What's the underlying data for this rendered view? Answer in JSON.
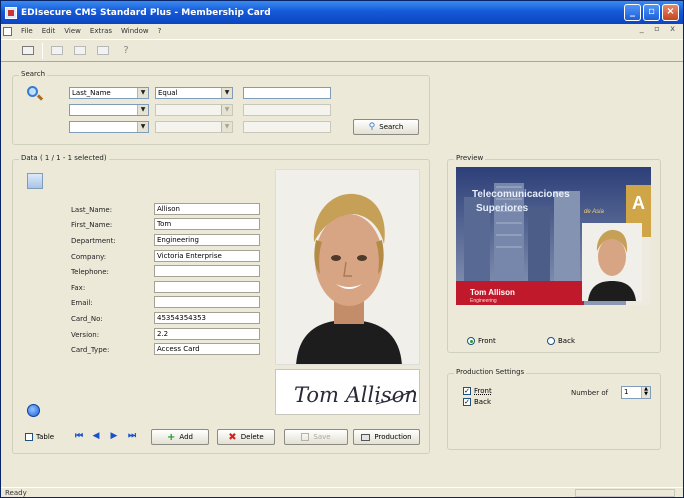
{
  "window": {
    "title": "EDIsecure CMS Standard Plus - Membership Card",
    "menu": [
      "File",
      "Edit",
      "View",
      "Extras",
      "Window",
      "?"
    ],
    "mdi_controls": "_ ▫ x"
  },
  "search": {
    "group_title": "Search",
    "rows": [
      {
        "field": "Last_Name",
        "operator": "Equal",
        "value": ""
      },
      {
        "field": "",
        "operator": "",
        "value": ""
      },
      {
        "field": "",
        "operator": "",
        "value": ""
      }
    ],
    "search_button": "Search"
  },
  "data_group": {
    "title": "Data ( 1 / 1 - 1 selected)",
    "fields": [
      {
        "label": "Last_Name:",
        "value": "Allison"
      },
      {
        "label": "First_Name:",
        "value": "Tom"
      },
      {
        "label": "Department:",
        "value": "Engineering"
      },
      {
        "label": "Company:",
        "value": "Victoria Enterprise"
      },
      {
        "label": "Telephone:",
        "value": ""
      },
      {
        "label": "Fax:",
        "value": ""
      },
      {
        "label": "Email:",
        "value": ""
      },
      {
        "label": "Card_No:",
        "value": "45354354353"
      },
      {
        "label": "Version:",
        "value": "2.2"
      },
      {
        "label": "Card_Type:",
        "value": "Access Card"
      }
    ],
    "signature_text": "Tom Allison",
    "table_checkbox_label": "Table",
    "buttons": {
      "add": "Add",
      "delete": "Delete",
      "save": "Save",
      "production": "Production"
    }
  },
  "preview": {
    "title": "Preview",
    "card": {
      "heading_line1": "Telecomunicaciones",
      "heading_line2": "Superiores",
      "tag": "de Asia",
      "corner_letter": "A",
      "name": "Tom Allison",
      "department": "Engineering"
    },
    "side_front": "Front",
    "side_back": "Back",
    "selected_side": "Front"
  },
  "production_settings": {
    "title": "Production Settings",
    "front_label": "Front",
    "back_label": "Back",
    "front_checked": true,
    "back_checked": true,
    "number_label": "Number of",
    "number_value": "1"
  },
  "status": {
    "text": "Ready"
  },
  "colors": {
    "titlebar": "#1559d8",
    "card_banner": "#c0192b",
    "card_corner": "#cfa548",
    "nav_blue": "#1b4fcd"
  }
}
